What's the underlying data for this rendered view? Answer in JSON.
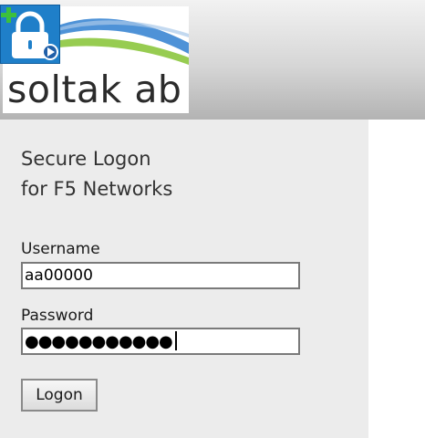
{
  "brand": {
    "logo_text": "soltak ab"
  },
  "login": {
    "title_line1": "Secure Logon",
    "title_line2": "for F5 Networks",
    "username_label": "Username",
    "username_value": "aa00000",
    "password_label": "Password",
    "password_dots": "●●●●●●●●●●●",
    "logon_label": "Logon"
  },
  "colors": {
    "badge_blue": "#1f7fc9",
    "badge_plus": "#3cc03c",
    "wave_blue": "#2f7fd0",
    "wave_green": "#8cc63e"
  },
  "icons": {
    "badge": "lock-icon",
    "badge_add": "plus-icon",
    "badge_play": "play-icon"
  }
}
